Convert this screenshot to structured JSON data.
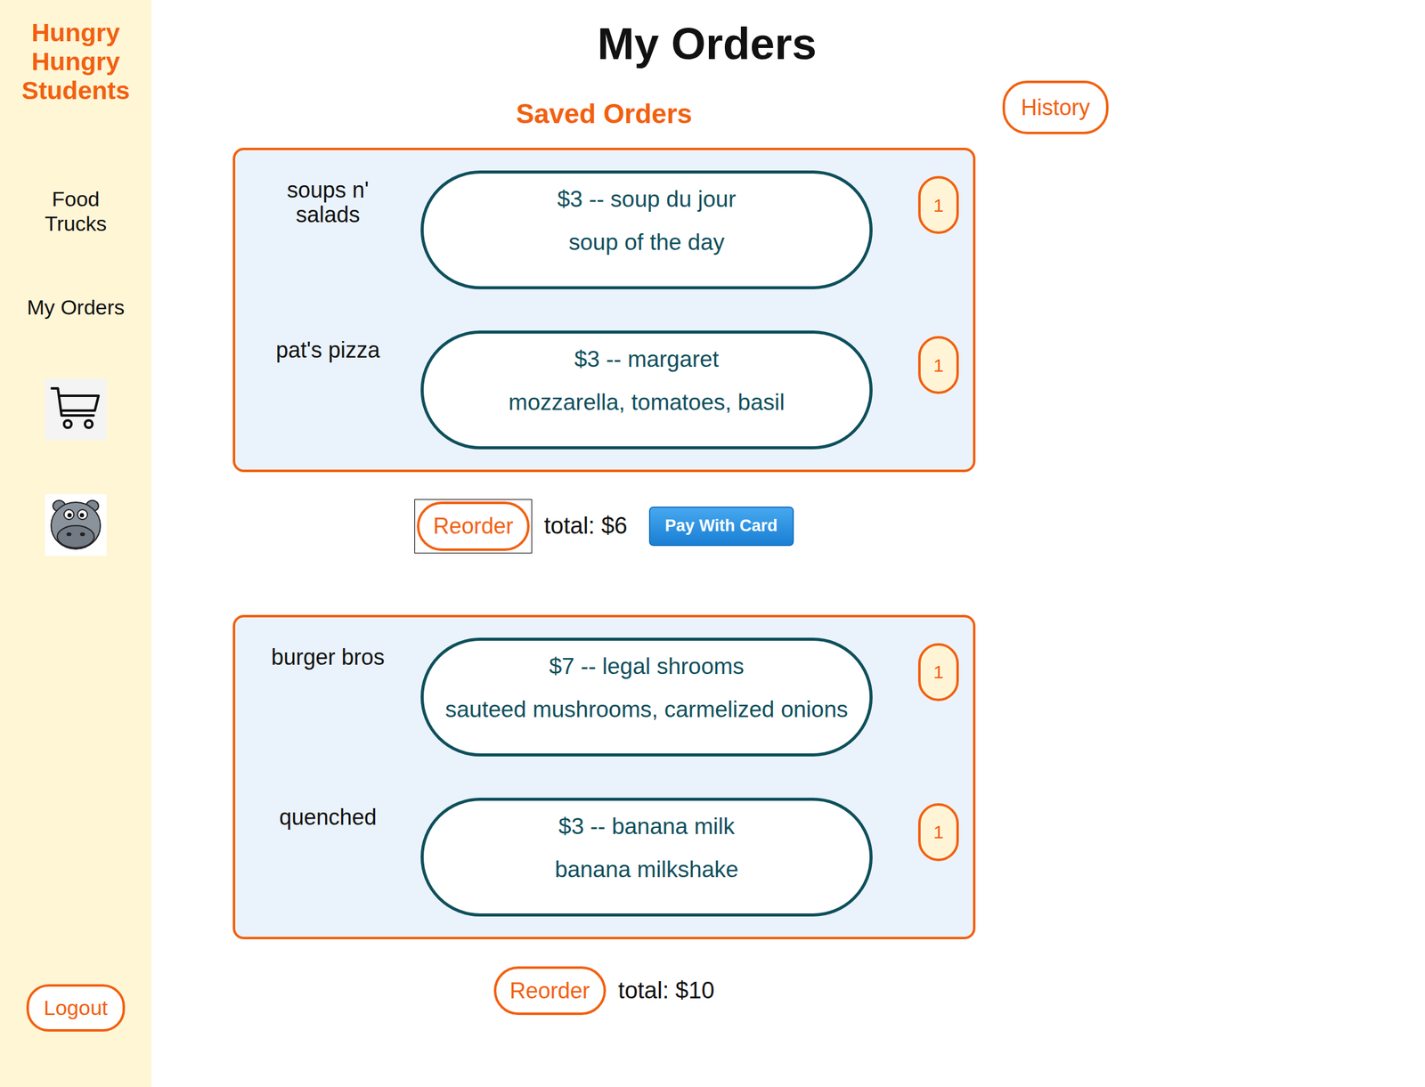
{
  "app": {
    "logo": "Hungry Hungry Students"
  },
  "sidebar": {
    "items": [
      {
        "label": "Food Trucks"
      },
      {
        "label": "My Orders"
      }
    ],
    "logout": "Logout"
  },
  "page": {
    "title": "My Orders",
    "section": "Saved Orders",
    "history": "History"
  },
  "orders": [
    {
      "items": [
        {
          "truck": "soups n' salads",
          "title": "$3 -- soup du jour",
          "description": "soup of the day",
          "quantity": "1"
        },
        {
          "truck": "pat's pizza",
          "title": "$3 -- margaret",
          "description": "mozzarella, tomatoes, basil",
          "quantity": "1"
        }
      ],
      "reorder": "Reorder",
      "focused": true,
      "total": "total: $6",
      "pay": "Pay With Card"
    },
    {
      "items": [
        {
          "truck": "burger bros",
          "title": "$7 -- legal shrooms",
          "description": "sauteed mushrooms, carmelized onions",
          "quantity": "1"
        },
        {
          "truck": "quenched",
          "title": "$3 -- banana milk",
          "description": "banana milkshake",
          "quantity": "1"
        }
      ],
      "reorder": "Reorder",
      "focused": false,
      "total": "total: $10"
    }
  ]
}
